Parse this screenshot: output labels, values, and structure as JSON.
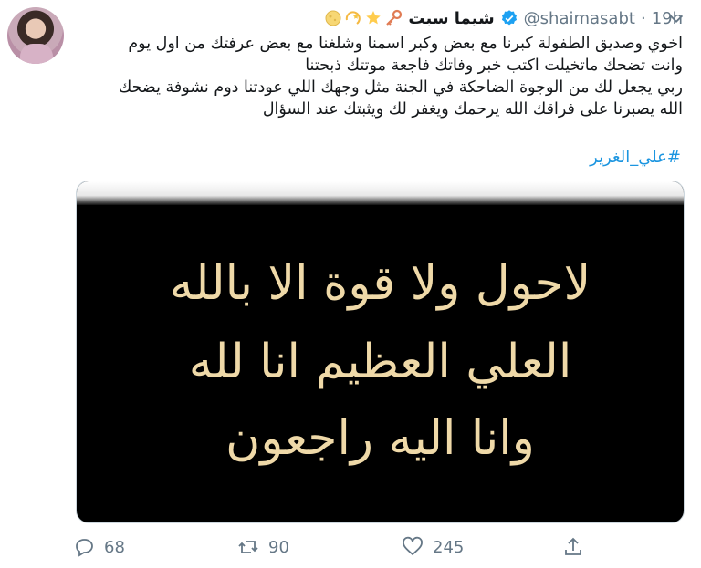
{
  "tweet": {
    "display_name": "شيما سبت",
    "handle": "@shaimasabt",
    "separator": "·",
    "time": "19h",
    "name_emojis": [
      "key-emoji",
      "star-emoji",
      "dizzy-emoji",
      "full-moon-emoji"
    ],
    "text_lines": [
      "اخوي وصديق الطفولة كبرنا مع بعض وكبر اسمنا وشلغنا مع بعض عرفتك من اول يوم",
      "وانت تضحك ماتخيلت اكتب خبر وفاتك فاجعة موتتك ذبحتنا",
      "ربي يجعل لك من الوجوة الضاحكة في الجنة مثل وجهك اللي عودتنا دوم نشوفة يضحك",
      "الله يصبرنا على فراقك الله يرحمك ويغفر لك ويثبتك عند السؤال"
    ],
    "hashtag": "#علي_الغرير",
    "media_lines": [
      "لاحول ولا قوة الا بالله",
      "العلي العظيم انا لله",
      "وانا اليه راجعون"
    ],
    "counts": {
      "replies": "68",
      "retweets": "90",
      "likes": "245"
    }
  },
  "colors": {
    "link": "#1b95e0",
    "muted": "#657786",
    "verified": "#1da1f2",
    "media_text": "#efd9a8"
  }
}
